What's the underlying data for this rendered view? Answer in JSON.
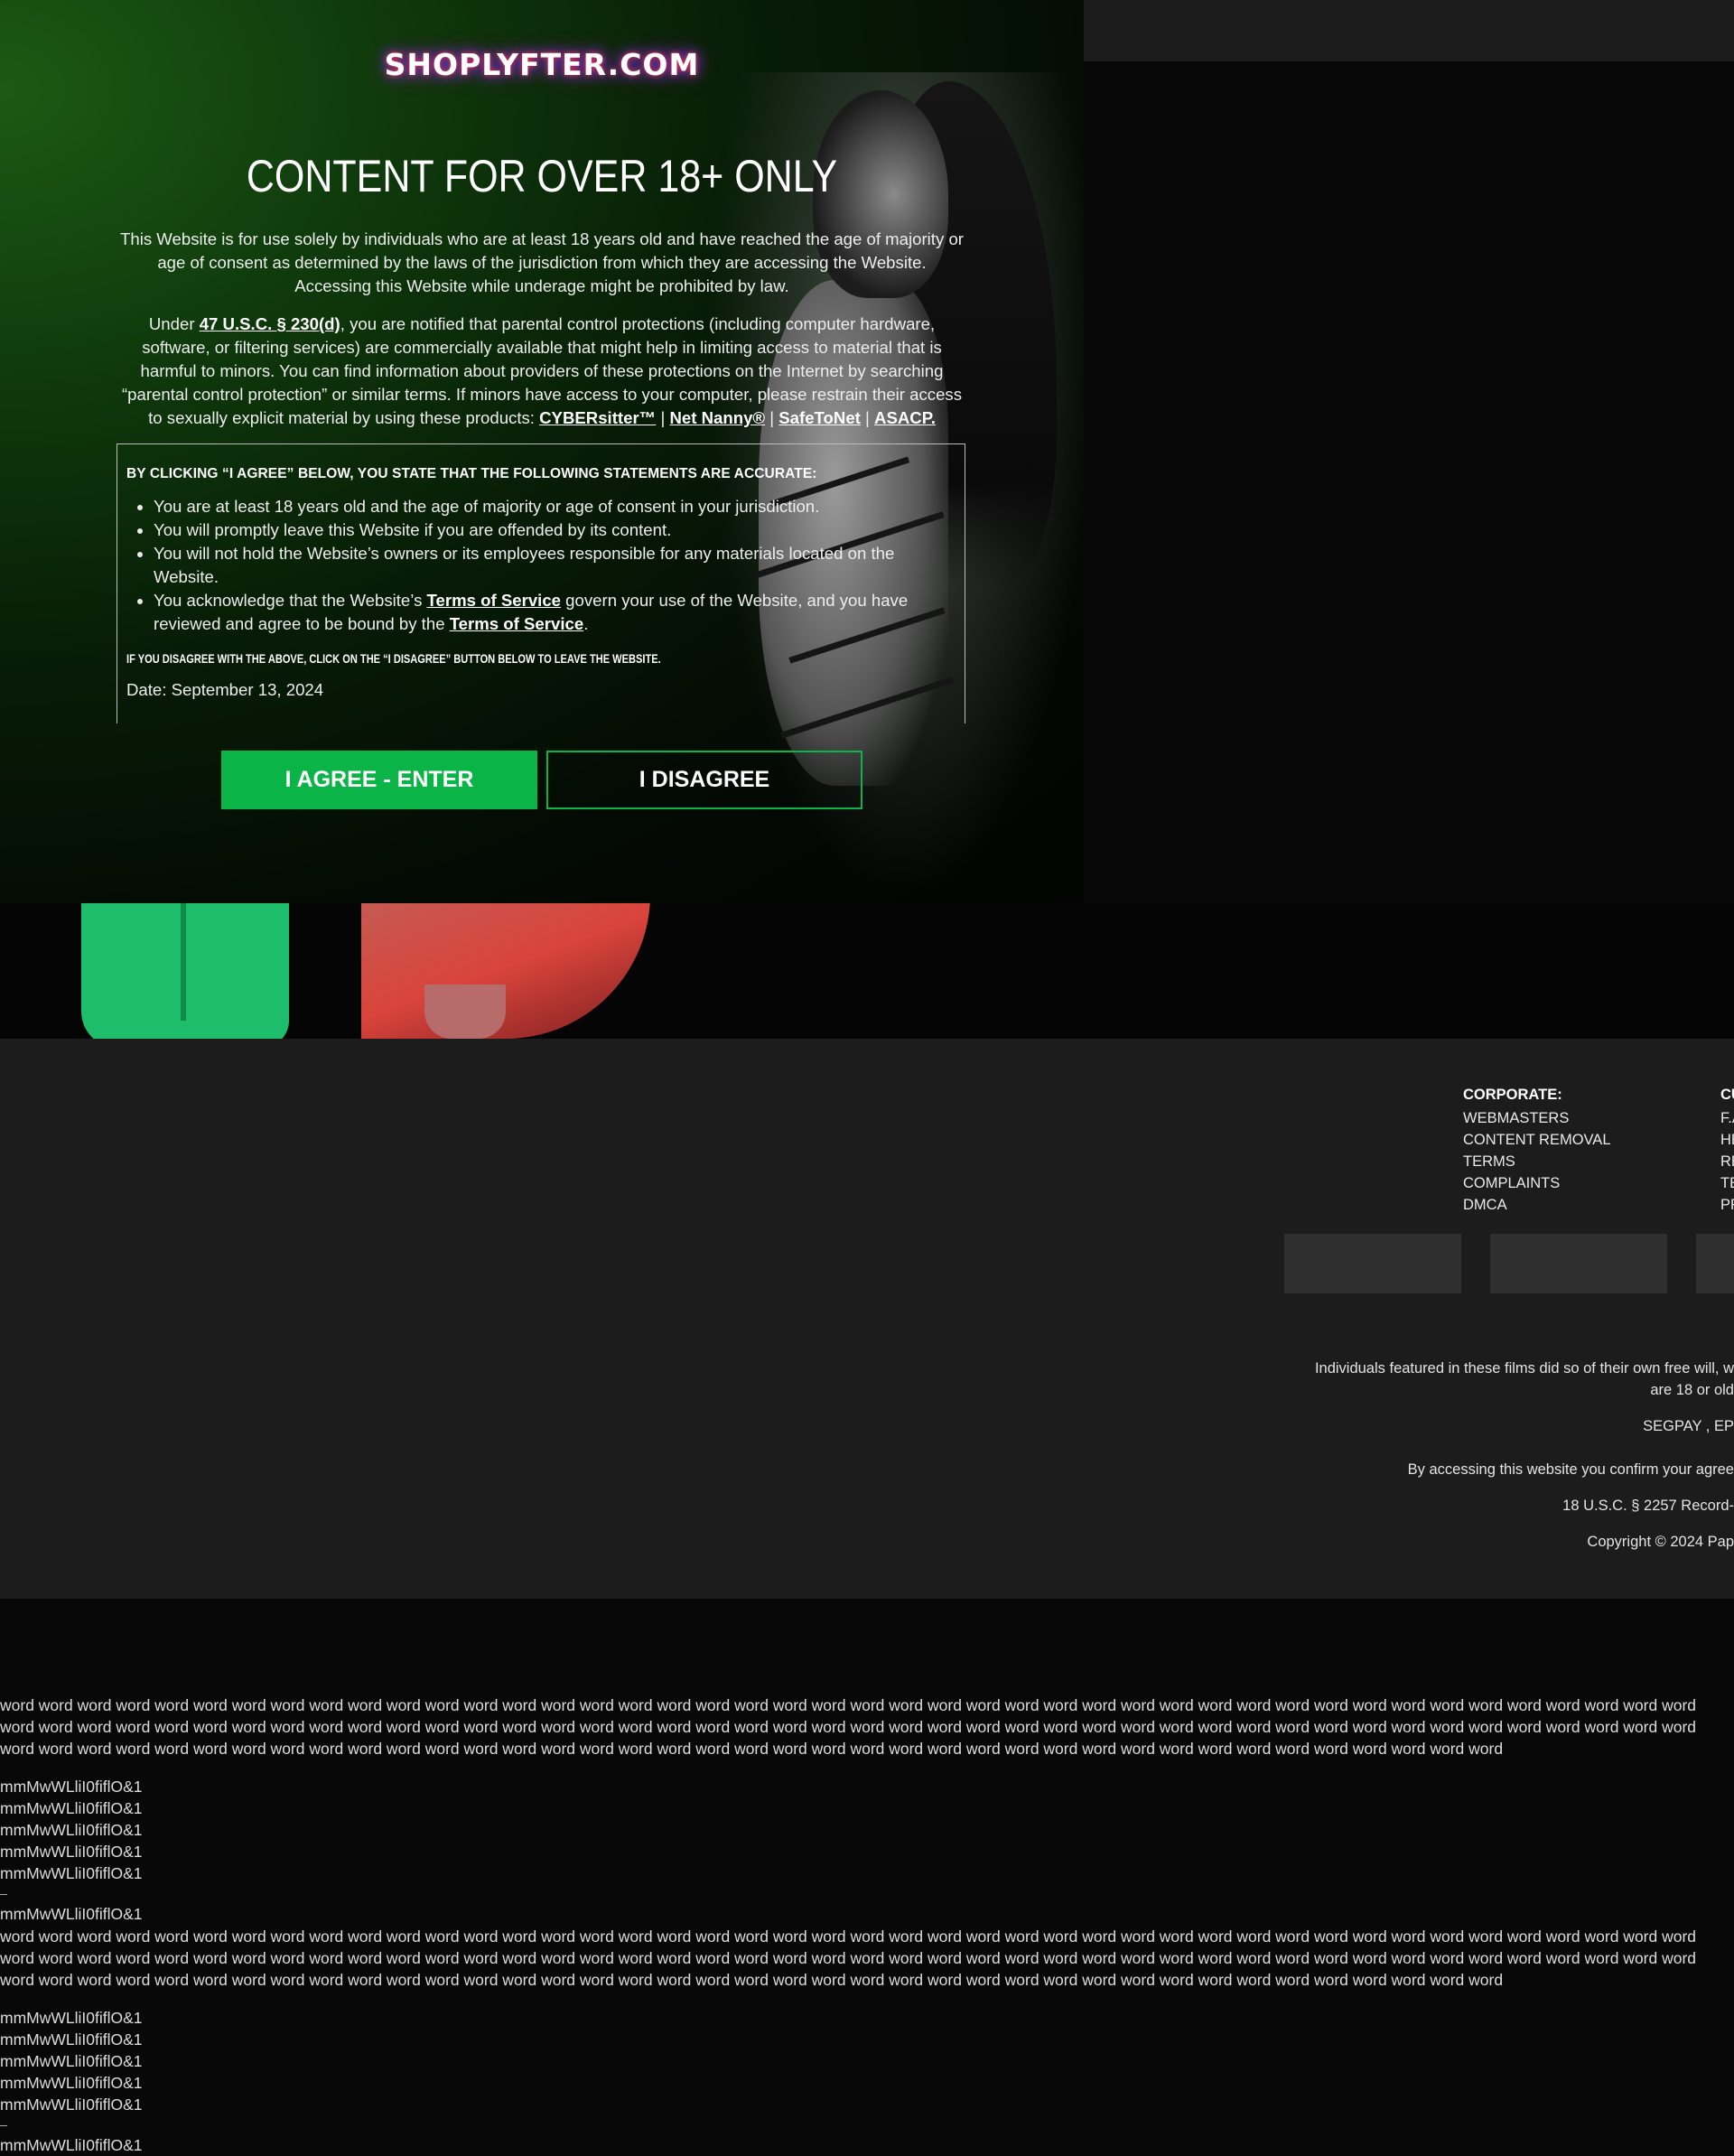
{
  "modal": {
    "logo": "SHOPLYFTER.COM",
    "title": "CONTENT FOR OVER 18+ ONLY",
    "intro": "This Website is for use solely by individuals who are at least 18 years old and have reached the age of majority or age of consent as determined by the laws of the jurisdiction from which they are accessing the Website. Accessing this Website while underage might be prohibited by law.",
    "parental": {
      "before": "Under ",
      "law_link": "47 U.S.C. § 230(d)",
      "after": ", you are notified that parental control protections (including computer hardware, software, or filtering services) are commercially available that might help in limiting access to material that is harmful to minors. You can find information about providers of these protections on the Internet by searching “parental control protection” or similar terms. If minors have access to your computer, please restrain their access to sexually explicit material by using these products: ",
      "products": [
        "CYBERsitter™",
        "Net Nanny®",
        "SafeToNet",
        "ASACP."
      ],
      "separator": " | "
    },
    "statements": {
      "heading": "BY CLICKING “I AGREE” BELOW, YOU STATE THAT THE FOLLOWING STATEMENTS ARE ACCURATE:",
      "item1": "You are at least 18 years old and the age of majority or age of consent in your jurisdiction.",
      "item2": "You will promptly leave this Website if you are offended by its content.",
      "item3": "You will not hold the Website’s owners or its employees responsible for any materials located on the Website.",
      "item4_a": "You acknowledge that the Website’s ",
      "item4_link1": "Terms of Service",
      "item4_b": " govern your use of the Website, and you have reviewed and agree to be bound by the ",
      "item4_link2": "Terms of Service",
      "item4_c": ".",
      "disagree_note": "IF YOU DISAGREE WITH THE ABOVE, CLICK ON THE “I DISAGREE” BUTTON BELOW TO LEAVE THE WEBSITE.",
      "date": "Date: September 13, 2024"
    },
    "agree_label": "I AGREE - ENTER",
    "disagree_label": "I DISAGREE"
  },
  "footer": {
    "corporate": {
      "heading": "CORPORATE:",
      "links": [
        "WEBMASTERS",
        "CONTENT REMOVAL",
        "TERMS",
        "COMPLAINTS",
        "DMCA"
      ]
    },
    "customer": {
      "heading": "CU",
      "links": [
        "F.A",
        "HE",
        "RE",
        "TE",
        "PR"
      ]
    },
    "lines": {
      "featured_1": "Individuals featured in these films did so of their own free will, w",
      "featured_2": "are 18 or old",
      "billing": "SEGPAY , EP",
      "accessing": "By accessing this website you confirm your agree",
      "records": "18 U.S.C. § 2257 Record-",
      "copyright": "Copyright © 2024 Pap"
    }
  },
  "filler": {
    "words_block": "word word word word word word word word word word word word word word word word word word word word word word word word word word word word word word word word word word word word word word word word word word word word word word word word word word word word word word word word word word word word word word word word word word word word word word word word word word word word word word word word word word word word word word word word word word word word word word word word word word word word word word word word word word word word word word word word word word word word word word word word word word word word word word word",
    "char_line": "mmMwWLliI0fiflO&1"
  },
  "colors": {
    "agree_button": "#0ab447",
    "disagree_border": "#0fb34c",
    "footer_bg": "#1c1c1c",
    "page_bg": "#080808"
  }
}
